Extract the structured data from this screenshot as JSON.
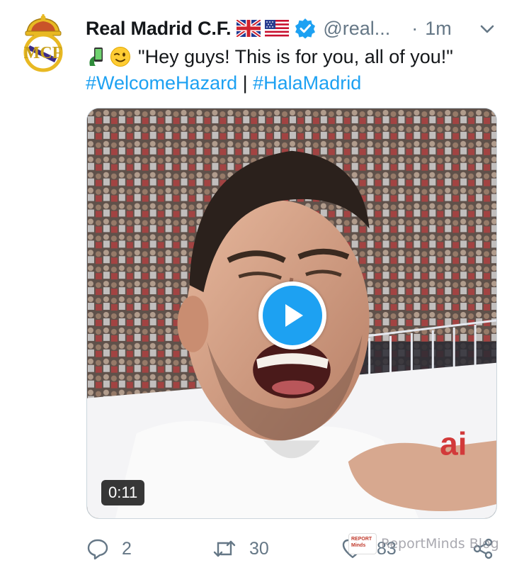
{
  "account": {
    "display_name": "Real Madrid C.F.",
    "handle": "@real...",
    "dot": "·",
    "time": "1m",
    "flags": [
      "uk-flag",
      "us-flag"
    ],
    "verified": true
  },
  "tweet": {
    "emojis": [
      "selfie-phone-emoji",
      "winking-face-emoji"
    ],
    "quote": "\"Hey guys! This is for you, all of you!\"",
    "hashtag_1": "#WelcomeHazard",
    "separator": "|",
    "hashtag_2": "#HalaMadrid"
  },
  "media": {
    "duration": "0:11",
    "play_icon": "play-icon"
  },
  "actions": {
    "reply_count": "2",
    "retweet_count": "30",
    "like_count": "83"
  },
  "watermark": {
    "logo_text": "REPORT Minds",
    "text": "ReportMinds Blog"
  },
  "colors": {
    "accent": "#1da1f2",
    "secondary_text": "#657786",
    "primary_text": "#14171a",
    "club_gold": "#e8b923",
    "club_purple": "#3b2a87"
  }
}
